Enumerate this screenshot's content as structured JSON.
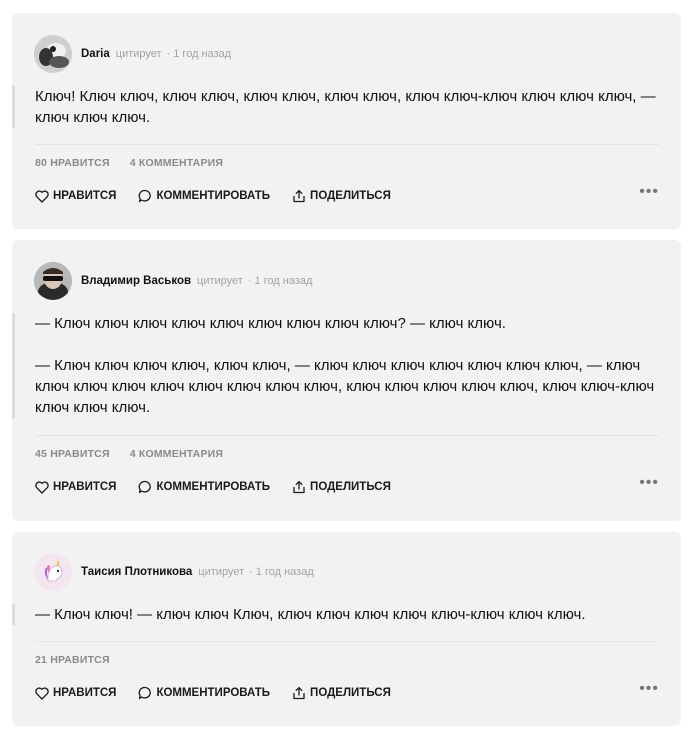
{
  "posts": [
    {
      "author": "Daria",
      "cites": "цитирует",
      "time": "1 год назад",
      "paragraphs": [
        "Ключ! Ключ ключ, ключ ключ, ключ ключ, ключ ключ, ключ ключ-ключ ключ ключ ключ, — ключ ключ ключ."
      ],
      "likes": "80 НРАВИТСЯ",
      "comments": "4 КОММЕНТАРИЯ"
    },
    {
      "author": "Владимир Васьков",
      "cites": "цитирует",
      "time": "1 год назад",
      "paragraphs": [
        "— Ключ ключ ключ ключ ключ ключ ключ ключ ключ? — ключ ключ.",
        "— Ключ ключ ключ ключ, ключ ключ, — ключ ключ ключ ключ ключ ключ ключ, — ключ ключ ключ ключ ключ ключ ключ ключ ключ, ключ ключ ключ ключ ключ, ключ ключ-ключ ключ ключ ключ."
      ],
      "likes": "45 НРАВИТСЯ",
      "comments": "4 КОММЕНТАРИЯ"
    },
    {
      "author": "Таисия Плотникова",
      "cites": "цитирует",
      "time": "1 год назад",
      "paragraphs": [
        "— Ключ ключ! — ключ ключ Ключ, ключ ключ ключ ключ ключ-ключ ключ ключ."
      ],
      "likes": "21 НРАВИТСЯ",
      "comments": ""
    }
  ],
  "actions": {
    "like": "НРАВИТСЯ",
    "comment": "КОММЕНТИРОВАТЬ",
    "share": "ПОДЕЛИТЬСЯ",
    "more": "•••"
  },
  "icons": {
    "like": "heart-icon",
    "comment": "comment-icon",
    "share": "share-icon",
    "more": "more-icon"
  }
}
